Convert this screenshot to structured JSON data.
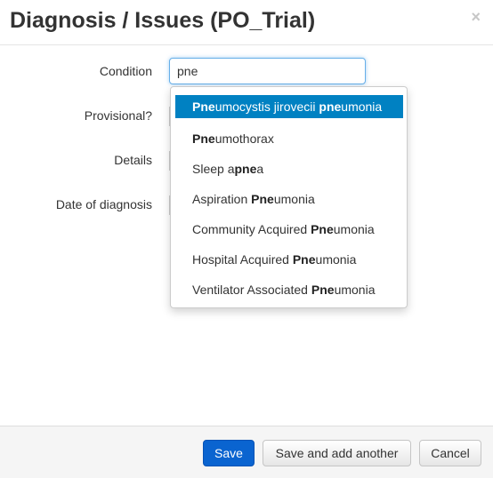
{
  "modal": {
    "title": "Diagnosis / Issues (PO_Trial)",
    "close_symbol": "×"
  },
  "form": {
    "condition_label": "Condition",
    "condition_value": "pne",
    "provisional_label": "Provisional?",
    "details_label": "Details",
    "date_label": "Date of diagnosis"
  },
  "autocomplete": {
    "query": "pne",
    "items": [
      {
        "parts": [
          {
            "t": "Pne",
            "b": true
          },
          {
            "t": "umocystis jirovecii ",
            "b": false
          },
          {
            "t": "pne",
            "b": true
          },
          {
            "t": "umonia",
            "b": false
          }
        ],
        "active": true
      },
      {
        "parts": [
          {
            "t": "Pne",
            "b": true
          },
          {
            "t": "umothorax",
            "b": false
          }
        ],
        "active": false
      },
      {
        "parts": [
          {
            "t": "Sleep a",
            "b": false
          },
          {
            "t": "pne",
            "b": true
          },
          {
            "t": "a",
            "b": false
          }
        ],
        "active": false
      },
      {
        "parts": [
          {
            "t": "Aspiration ",
            "b": false
          },
          {
            "t": "Pne",
            "b": true
          },
          {
            "t": "umonia",
            "b": false
          }
        ],
        "active": false
      },
      {
        "parts": [
          {
            "t": "Community Acquired ",
            "b": false
          },
          {
            "t": "Pne",
            "b": true
          },
          {
            "t": "umonia",
            "b": false
          }
        ],
        "active": false
      },
      {
        "parts": [
          {
            "t": "Hospital Acquired ",
            "b": false
          },
          {
            "t": "Pne",
            "b": true
          },
          {
            "t": "umonia",
            "b": false
          }
        ],
        "active": false
      },
      {
        "parts": [
          {
            "t": "Ventilator Associated ",
            "b": false
          },
          {
            "t": "Pne",
            "b": true
          },
          {
            "t": "umonia",
            "b": false
          }
        ],
        "active": false
      }
    ]
  },
  "footer": {
    "save_label": "Save",
    "save_add_label": "Save and add another",
    "cancel_label": "Cancel"
  },
  "colors": {
    "primary": "#0a64d0",
    "highlight": "#0081c2",
    "focus_border": "#66afe9"
  }
}
